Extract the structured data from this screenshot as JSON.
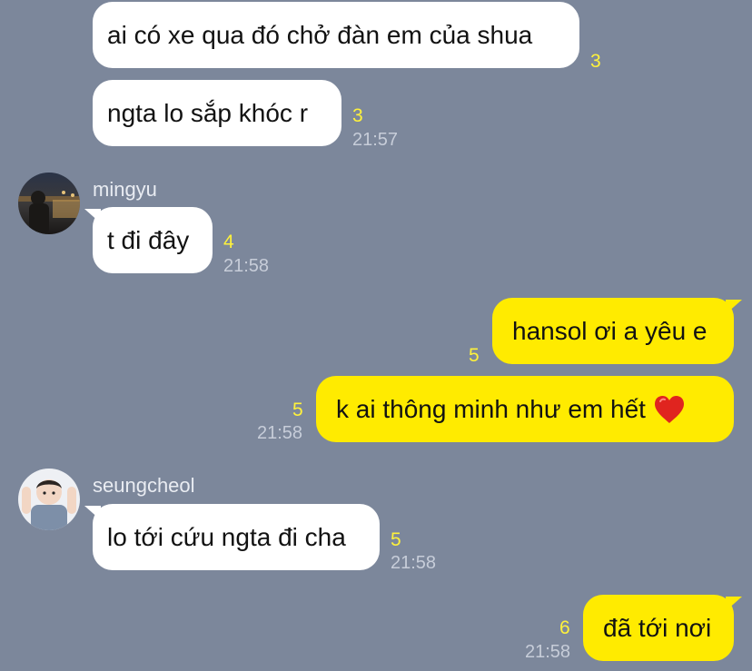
{
  "messages": [
    {
      "text": "ai có xe qua đó chở đàn em của shua",
      "unread": "3"
    },
    {
      "text": "ngta lo sắp khóc r",
      "unread": "3",
      "time": "21:57"
    },
    {
      "sender": "mingyu",
      "text": "t đi đây",
      "unread": "4",
      "time": "21:58"
    },
    {
      "text": "hansol ơi a yêu e",
      "unread": "5"
    },
    {
      "text": "k ai thông minh như em hết",
      "emoji": "red-heart-icon",
      "unread": "5",
      "time": "21:58"
    },
    {
      "sender": "seungcheol",
      "text": "lo tới cứu ngta đi cha",
      "unread": "5",
      "time": "21:58"
    },
    {
      "text": "đã tới nơi",
      "unread": "6",
      "time": "21:58"
    }
  ],
  "colors": {
    "background": "#7c879b",
    "incoming": "#ffffff",
    "outgoing": "#ffeb00",
    "unread": "#fff23b"
  }
}
